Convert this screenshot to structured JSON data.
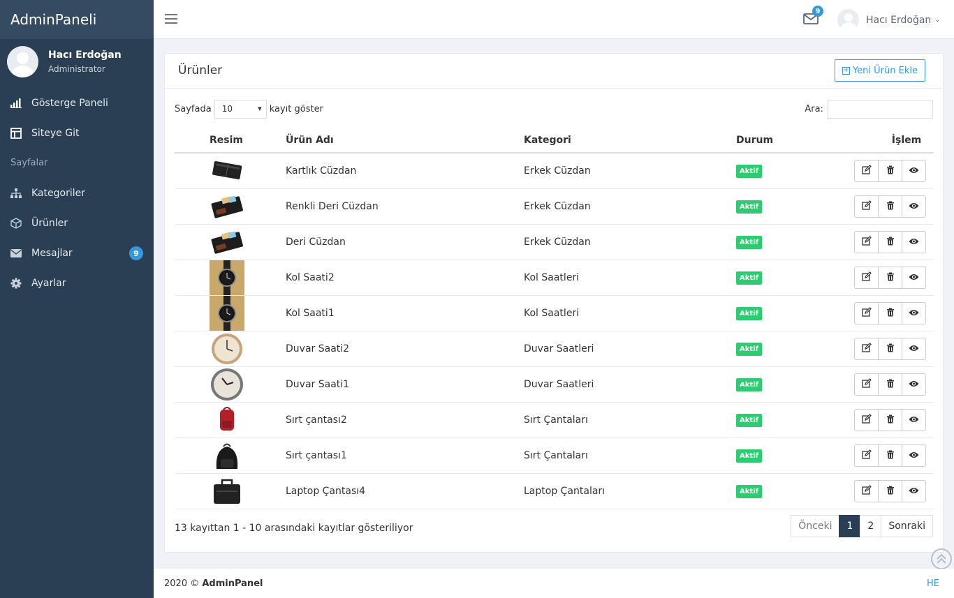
{
  "brand": "AdminPaneli",
  "profile": {
    "name": "Hacı Erdoğan",
    "role": "Administrator"
  },
  "nav": {
    "dashboard": "Gösterge Paneli",
    "site": "Siteye Git",
    "section": "Sayfalar",
    "categories": "Kategoriler",
    "products": "Ürünler",
    "messages": "Mesajlar",
    "messages_badge": "9",
    "settings": "Ayarlar"
  },
  "topbar": {
    "mail_badge": "9",
    "user_name": "Hacı Erdoğan"
  },
  "panel": {
    "title": "Ürünler",
    "add_label": "Yeni Ürün Ekle",
    "length_prefix": "Sayfada",
    "length_value": "10",
    "length_suffix": "kayıt göster",
    "search_label": "Ara:",
    "columns": [
      "Resim",
      "Ürün Adı",
      "Kategori",
      "Durum",
      "İşlem"
    ],
    "rows": [
      {
        "name": "Kartlık Cüzdan",
        "category": "Erkek Cüzdan",
        "status": "Aktif",
        "thumb": "card-wallet"
      },
      {
        "name": "Renkli Deri Cüzdan",
        "category": "Erkek Cüzdan",
        "status": "Aktif",
        "thumb": "wallet"
      },
      {
        "name": "Deri Cüzdan",
        "category": "Erkek Cüzdan",
        "status": "Aktif",
        "thumb": "wallet"
      },
      {
        "name": "Kol Saati2",
        "category": "Kol Saatleri",
        "status": "Aktif",
        "thumb": "wristwatch"
      },
      {
        "name": "Kol Saati1",
        "category": "Kol Saatleri",
        "status": "Aktif",
        "thumb": "wristwatch"
      },
      {
        "name": "Duvar Saati2",
        "category": "Duvar Saatleri",
        "status": "Aktif",
        "thumb": "wall-clock-light"
      },
      {
        "name": "Duvar Saati1",
        "category": "Duvar Saatleri",
        "status": "Aktif",
        "thumb": "wall-clock-dark"
      },
      {
        "name": "Sırt çantası2",
        "category": "Sırt Çantaları",
        "status": "Aktif",
        "thumb": "backpack-red"
      },
      {
        "name": "Sırt çantası1",
        "category": "Sırt Çantaları",
        "status": "Aktif",
        "thumb": "backpack-black"
      },
      {
        "name": "Laptop Çantası4",
        "category": "Laptop Çantaları",
        "status": "Aktif",
        "thumb": "laptop-bag"
      }
    ],
    "info": "13 kayıttan 1 - 10 arasındaki kayıtlar gösteriliyor",
    "pagination": {
      "prev": "Önceki",
      "pages": [
        "1",
        "2"
      ],
      "active": "1",
      "next": "Sonraki"
    }
  },
  "footer": {
    "year": "2020 ©",
    "name": "AdminPanel",
    "right": "HE"
  },
  "colors": {
    "sidebar": "#2a3f54",
    "accent": "#3498db",
    "success": "#2dcc70"
  }
}
